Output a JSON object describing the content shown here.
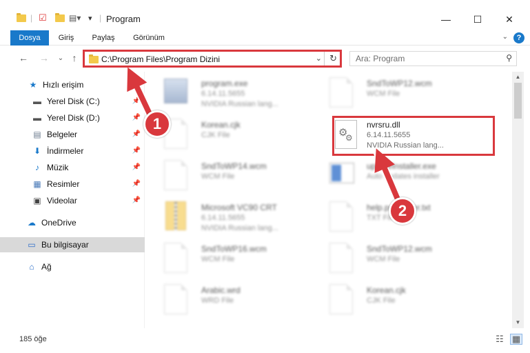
{
  "window": {
    "title": "Program",
    "minimize": "—",
    "maximize": "☐",
    "close": "✕"
  },
  "ribbon": {
    "tabs": [
      {
        "label": "Dosya",
        "active": true
      },
      {
        "label": "Giriş"
      },
      {
        "label": "Paylaş"
      },
      {
        "label": "Görünüm"
      }
    ],
    "help": "?"
  },
  "address": {
    "path": "C:\\Program Files\\Program Dizini"
  },
  "search": {
    "placeholder": "Ara: Program"
  },
  "sidebar": {
    "items": [
      {
        "label": "Hızlı erişim",
        "icon": "star-icon"
      },
      {
        "label": "Yerel Disk (C:)",
        "icon": "drive-icon",
        "pinned": true
      },
      {
        "label": "Yerel Disk (D:)",
        "icon": "drive-icon",
        "pinned": true
      },
      {
        "label": "Belgeler",
        "icon": "documents-icon",
        "pinned": true
      },
      {
        "label": "İndirmeler",
        "icon": "download-icon",
        "pinned": true
      },
      {
        "label": "Müzik",
        "icon": "music-icon",
        "pinned": true
      },
      {
        "label": "Resimler",
        "icon": "pictures-icon",
        "pinned": true
      },
      {
        "label": "Videolar",
        "icon": "videos-icon",
        "pinned": true
      },
      {
        "label": "OneDrive",
        "icon": "cloud-icon"
      },
      {
        "label": "Bu bilgisayar",
        "icon": "computer-icon",
        "selected": true
      },
      {
        "label": "Ağ",
        "icon": "network-icon"
      }
    ]
  },
  "files": [
    {
      "name": "program.exe",
      "line2": "6.14.11.5655",
      "line3": "NVIDIA Russian lang...",
      "icon": "exe"
    },
    {
      "name": "SndToWP12.wcm",
      "line2": "WCM File",
      "line3": "",
      "icon": "doc"
    },
    {
      "name": "Korean.cjk",
      "line2": "CJK File",
      "line3": "",
      "icon": "doc"
    },
    {
      "name": "nvrsru.dll",
      "line2": "6.14.11.5655",
      "line3": "NVIDIA Russian lang...",
      "icon": "gear",
      "highlighted": true
    },
    {
      "name": "SndToWP14.wcm",
      "line2": "WCM File",
      "line3": "",
      "icon": "doc"
    },
    {
      "name": "updateInstaller.exe",
      "line2": "Auto updates installer",
      "line3": "",
      "icon": "win"
    },
    {
      "name": "Microsoft VC90 CRT",
      "line2": "6.14.11.5655",
      "line3": "NVIDIA Russian lang...",
      "icon": "zip"
    },
    {
      "name": "help.pdfreader.txt",
      "line2": "TXT File",
      "line3": "",
      "icon": "doc"
    },
    {
      "name": "SndToWP16.wcm",
      "line2": "WCM File",
      "line3": "",
      "icon": "doc"
    },
    {
      "name": "SndToWP12.wcm",
      "line2": "WCM File",
      "line3": "",
      "icon": "doc"
    },
    {
      "name": "Arabic.wrd",
      "line2": "WRD File",
      "line3": "",
      "icon": "doc"
    },
    {
      "name": "Korean.cjk",
      "line2": "CJK File",
      "line3": "",
      "icon": "doc"
    }
  ],
  "status": {
    "count": "185 öğe"
  },
  "annotations": {
    "badge1": "1",
    "badge2": "2",
    "color": "#d9383d"
  }
}
